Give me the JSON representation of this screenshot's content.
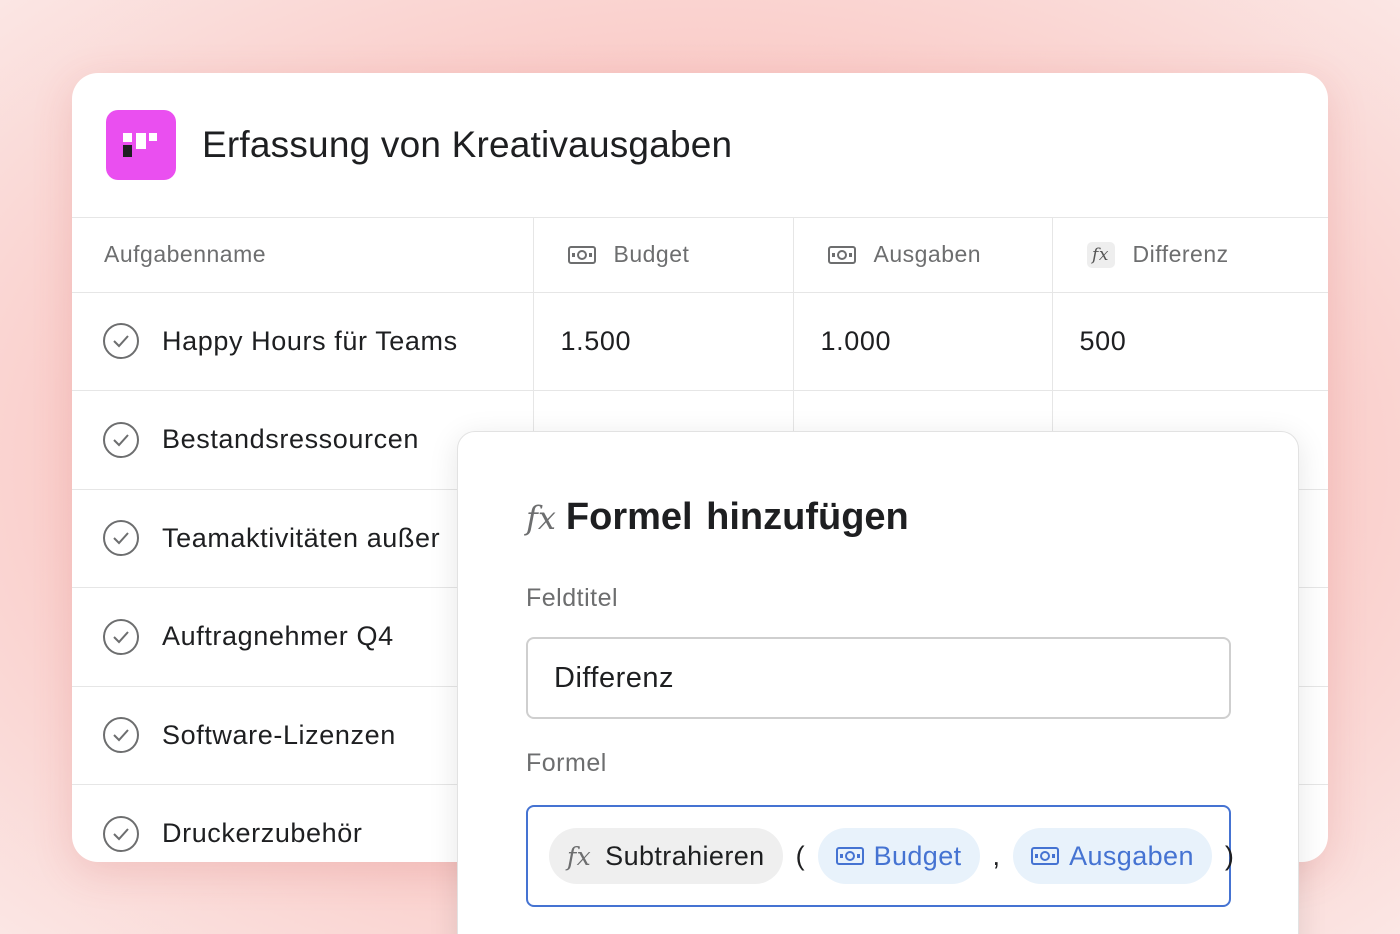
{
  "header": {
    "title": "Erfassung von Kreativausgaben"
  },
  "table": {
    "columns": [
      {
        "label": "Aufgabenname",
        "icon": ""
      },
      {
        "label": "Budget",
        "icon": "money-icon"
      },
      {
        "label": "Ausgaben",
        "icon": "money-icon"
      },
      {
        "label": "Differenz",
        "icon": "fx-icon"
      }
    ],
    "rows": [
      {
        "name": "Happy Hours für Teams",
        "budget": "1.500",
        "ausgaben": "1.000",
        "differenz": "500"
      },
      {
        "name": "Bestandsressourcen",
        "budget": "",
        "ausgaben": "",
        "differenz": ""
      },
      {
        "name": "Teamaktivitäten außer",
        "budget": "",
        "ausgaben": "",
        "differenz": ""
      },
      {
        "name": "Auftragnehmer Q4",
        "budget": "",
        "ausgaben": "",
        "differenz": ""
      },
      {
        "name": "Software-Lizenzen",
        "budget": "",
        "ausgaben": "",
        "differenz": ""
      },
      {
        "name": "Druckerzubehör",
        "budget": "",
        "ausgaben": "",
        "differenz": ""
      }
    ]
  },
  "panel": {
    "fx": "fx",
    "title": "Formel hinzufügen",
    "field_label": "Feldtitel",
    "field_value": "Differenz",
    "formula_label": "Formel",
    "formula": {
      "function": "Subtrahieren",
      "open": "(",
      "arg1": "Budget",
      "sep": ",",
      "arg2": "Ausgaben",
      "close": ")"
    }
  },
  "colors": {
    "accent": "#4573d2",
    "app_icon": "#ea4ff0",
    "background": "#f9c3bf"
  }
}
